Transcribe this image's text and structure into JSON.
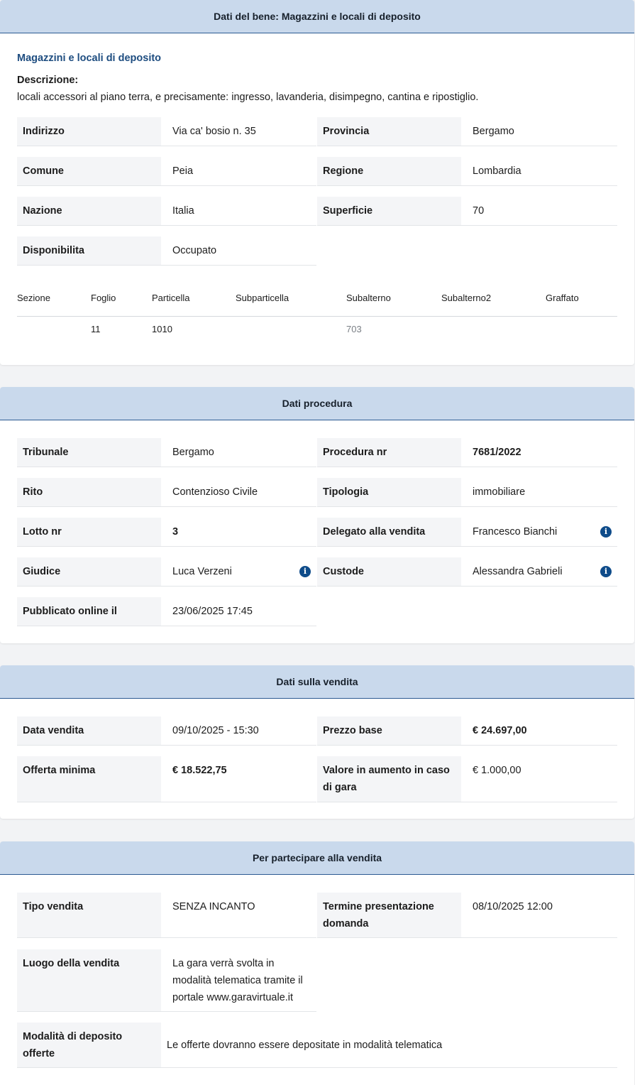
{
  "bene": {
    "header": "Dati del bene: Magazzini e locali di deposito",
    "subtitle": "Magazzini e locali di deposito",
    "descrizione_label": "Descrizione:",
    "descrizione_text": "locali accessori al piano terra, e precisamente: ingresso, lavanderia, disimpegno, cantina e ripostiglio.",
    "fields": {
      "indirizzo": {
        "label": "Indirizzo",
        "value": "Via ca' bosio n. 35"
      },
      "provincia": {
        "label": "Provincia",
        "value": "Bergamo"
      },
      "comune": {
        "label": "Comune",
        "value": "Peia"
      },
      "regione": {
        "label": "Regione",
        "value": "Lombardia"
      },
      "nazione": {
        "label": "Nazione",
        "value": "Italia"
      },
      "superficie": {
        "label": "Superficie",
        "value": "70"
      },
      "disponibilita": {
        "label": "Disponibilita",
        "value": "Occupato"
      }
    },
    "catasto": {
      "headers": [
        "Sezione",
        "Foglio",
        "Particella",
        "Subparticella",
        "Subalterno",
        "Subalterno2",
        "Graffato"
      ],
      "row": [
        "",
        "11",
        "1010",
        "",
        "703",
        "",
        ""
      ]
    }
  },
  "procedura": {
    "header": "Dati procedura",
    "fields": {
      "tribunale": {
        "label": "Tribunale",
        "value": "Bergamo"
      },
      "procedura_nr": {
        "label": "Procedura nr",
        "value": "7681/2022"
      },
      "rito": {
        "label": "Rito",
        "value": "Contenzioso Civile"
      },
      "tipologia": {
        "label": "Tipologia",
        "value": "immobiliare"
      },
      "lotto_nr": {
        "label": "Lotto nr",
        "value": "3"
      },
      "delegato": {
        "label": "Delegato alla vendita",
        "value": "Francesco Bianchi"
      },
      "giudice": {
        "label": "Giudice",
        "value": "Luca Verzeni"
      },
      "custode": {
        "label": "Custode",
        "value": "Alessandra Gabrieli"
      },
      "pubblicato": {
        "label": "Pubblicato online il",
        "value": "23/06/2025 17:45"
      }
    },
    "info_icon_glyph": "i"
  },
  "vendita": {
    "header": "Dati sulla vendita",
    "fields": {
      "data_vendita": {
        "label": "Data vendita",
        "value": "09/10/2025 - 15:30"
      },
      "prezzo_base": {
        "label": "Prezzo base",
        "value": "€ 24.697,00"
      },
      "offerta_minima": {
        "label": "Offerta minima",
        "value": "€ 18.522,75"
      },
      "valore_aumento": {
        "label": "Valore in aumento in caso di gara",
        "value": "€ 1.000,00"
      }
    }
  },
  "partecipare": {
    "header": "Per partecipare alla vendita",
    "fields": {
      "tipo_vendita": {
        "label": "Tipo vendita",
        "value": "SENZA INCANTO"
      },
      "termine": {
        "label": "Termine presentazione domanda",
        "value": "08/10/2025 12:00"
      },
      "luogo": {
        "label": "Luogo della vendita",
        "value": "La gara verrà svolta in modalità telematica tramite il portale www.garavirtuale.it"
      },
      "modalita": {
        "label": "Modalità di deposito offerte",
        "value": "Le offerte dovranno essere depositate in modalità telematica"
      }
    }
  },
  "colors": {
    "header_bg": "#c9d9ec",
    "header_border": "#2c5a92",
    "subtitle": "#1e4d80",
    "label_bg": "#f4f5f7",
    "info_icon": "#0f4c8a",
    "page_bg": "#f2f3f5"
  }
}
